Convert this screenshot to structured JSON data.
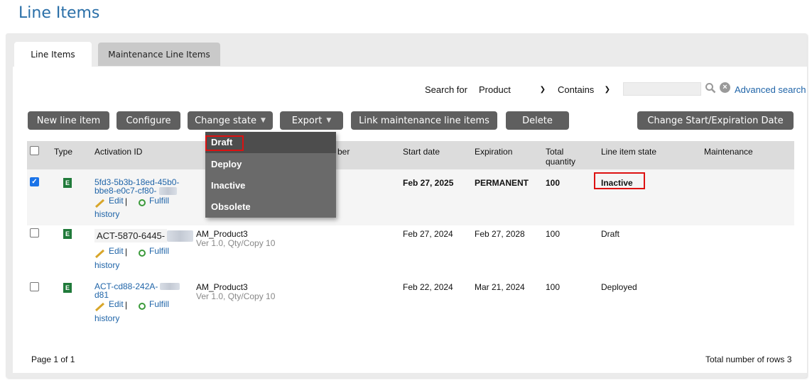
{
  "page": {
    "title": "Line Items"
  },
  "tabs": [
    {
      "label": "Line Items",
      "active": true
    },
    {
      "label": "Maintenance Line Items",
      "active": false
    }
  ],
  "search": {
    "label": "Search for",
    "field_value": "Product",
    "operator_value": "Contains",
    "input_value": "",
    "advanced_label": "Advanced search"
  },
  "toolbar": {
    "new_line_item": "New line item",
    "configure": "Configure",
    "change_state": "Change state",
    "export": "Export",
    "link_maintenance": "Link maintenance line items",
    "delete": "Delete",
    "change_dates": "Change Start/Expiration Date"
  },
  "change_state_menu": [
    "Draft",
    "Deploy",
    "Inactive",
    "Obsolete"
  ],
  "table": {
    "columns": [
      "Type",
      "Activation ID",
      "ber",
      "Start date",
      "Expiration",
      "Total quantity",
      "Line item state",
      "Maintenance"
    ],
    "rows": [
      {
        "checked": true,
        "type": "E",
        "activation_line1": "5fd3-5b3b-18ed-45b0-",
        "activation_line2": "bbe8-e0c7-cf80-",
        "product": "",
        "product_version": "",
        "start_date": "Feb 27, 2025",
        "expiration": "PERMANENT",
        "quantity": "100",
        "state": "Inactive",
        "maintenance": ""
      },
      {
        "checked": false,
        "type": "E",
        "activation_line1": "ACT-5870-6445-",
        "activation_line2": "",
        "product": "AM_Product3",
        "product_version": "Ver 1.0, Qty/Copy 10",
        "start_date": "Feb 27, 2024",
        "expiration": "Feb 27, 2028",
        "quantity": "100",
        "state": "Draft",
        "maintenance": ""
      },
      {
        "checked": false,
        "type": "E",
        "activation_line1": "ACT-cd88-242A-",
        "activation_line2": "d81",
        "product": "AM_Product3",
        "product_version": "Ver 1.0, Qty/Copy 10",
        "start_date": "Feb 22, 2024",
        "expiration": "Mar 21, 2024",
        "quantity": "100",
        "state": "Deployed",
        "maintenance": ""
      }
    ],
    "row_actions": {
      "edit": "Edit",
      "sep": "|",
      "fulfill": "Fulfill",
      "history": "history"
    }
  },
  "footer": {
    "page_info": "Page 1 of 1",
    "total_rows": "Total number of rows 3"
  },
  "colors": {
    "accent": "#2a6fa8",
    "button": "#5f5f5f",
    "highlight": "#d11111"
  }
}
